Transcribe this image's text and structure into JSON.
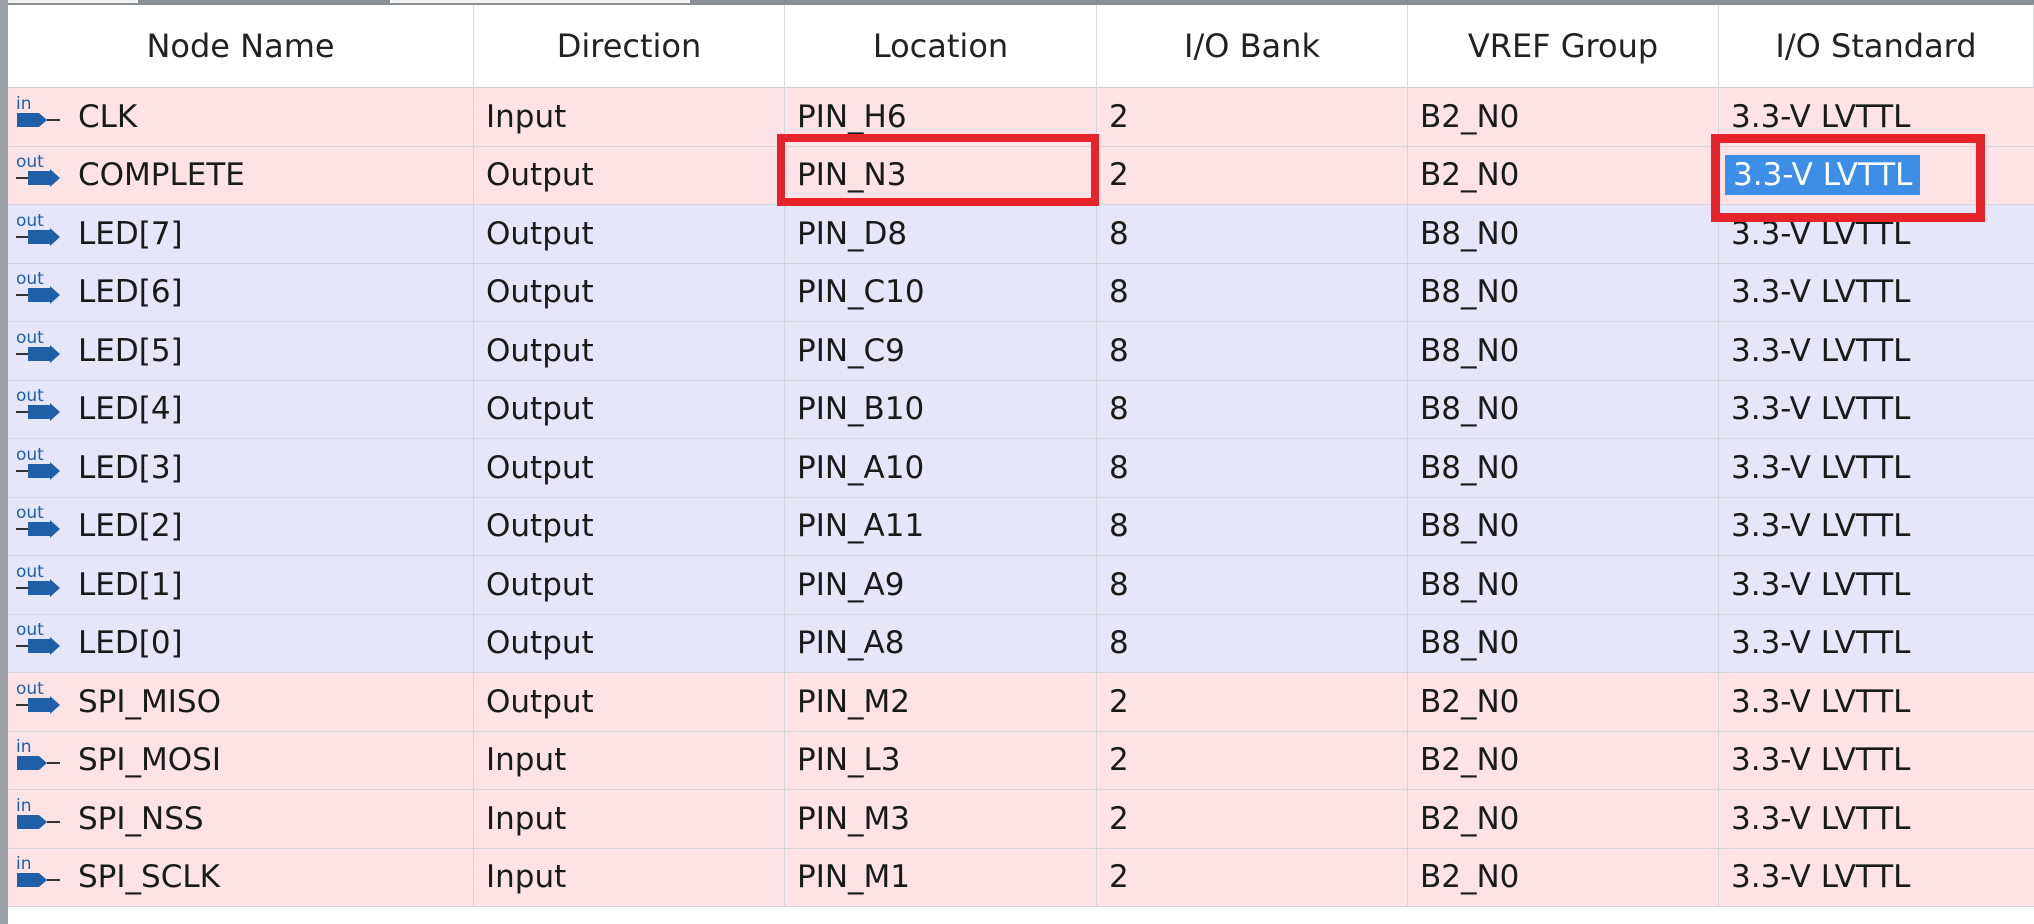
{
  "columns": [
    "Node Name",
    "Direction",
    "Location",
    "I/O Bank",
    "VREF Group",
    "I/O Standard"
  ],
  "rows": [
    {
      "dir_icon": "input-pin-icon",
      "icon_text": "in",
      "name": "CLK",
      "direction": "Input",
      "location": "PIN_H6",
      "bank": "2",
      "vref": "B2_N0",
      "standard": "3.3-V LVTTL",
      "tint": "pink"
    },
    {
      "dir_icon": "output-pin-icon",
      "icon_text": "out",
      "name": "COMPLETE",
      "direction": "Output",
      "location": "PIN_N3",
      "bank": "2",
      "vref": "B2_N0",
      "standard": "3.3-V LVTTL",
      "tint": "pink",
      "selected": true
    },
    {
      "dir_icon": "output-pin-icon",
      "icon_text": "out",
      "name": "LED[7]",
      "direction": "Output",
      "location": "PIN_D8",
      "bank": "8",
      "vref": "B8_N0",
      "standard": "3.3-V LVTTL",
      "tint": "lav"
    },
    {
      "dir_icon": "output-pin-icon",
      "icon_text": "out",
      "name": "LED[6]",
      "direction": "Output",
      "location": "PIN_C10",
      "bank": "8",
      "vref": "B8_N0",
      "standard": "3.3-V LVTTL",
      "tint": "lav"
    },
    {
      "dir_icon": "output-pin-icon",
      "icon_text": "out",
      "name": "LED[5]",
      "direction": "Output",
      "location": "PIN_C9",
      "bank": "8",
      "vref": "B8_N0",
      "standard": "3.3-V LVTTL",
      "tint": "lav"
    },
    {
      "dir_icon": "output-pin-icon",
      "icon_text": "out",
      "name": "LED[4]",
      "direction": "Output",
      "location": "PIN_B10",
      "bank": "8",
      "vref": "B8_N0",
      "standard": "3.3-V LVTTL",
      "tint": "lav"
    },
    {
      "dir_icon": "output-pin-icon",
      "icon_text": "out",
      "name": "LED[3]",
      "direction": "Output",
      "location": "PIN_A10",
      "bank": "8",
      "vref": "B8_N0",
      "standard": "3.3-V LVTTL",
      "tint": "lav"
    },
    {
      "dir_icon": "output-pin-icon",
      "icon_text": "out",
      "name": "LED[2]",
      "direction": "Output",
      "location": "PIN_A11",
      "bank": "8",
      "vref": "B8_N0",
      "standard": "3.3-V LVTTL",
      "tint": "lav"
    },
    {
      "dir_icon": "output-pin-icon",
      "icon_text": "out",
      "name": "LED[1]",
      "direction": "Output",
      "location": "PIN_A9",
      "bank": "8",
      "vref": "B8_N0",
      "standard": "3.3-V LVTTL",
      "tint": "lav"
    },
    {
      "dir_icon": "output-pin-icon",
      "icon_text": "out",
      "name": "LED[0]",
      "direction": "Output",
      "location": "PIN_A8",
      "bank": "8",
      "vref": "B8_N0",
      "standard": "3.3-V LVTTL",
      "tint": "lav"
    },
    {
      "dir_icon": "output-pin-icon",
      "icon_text": "out",
      "name": "SPI_MISO",
      "direction": "Output",
      "location": "PIN_M2",
      "bank": "2",
      "vref": "B2_N0",
      "standard": "3.3-V LVTTL",
      "tint": "pink"
    },
    {
      "dir_icon": "input-pin-icon",
      "icon_text": "in",
      "name": "SPI_MOSI",
      "direction": "Input",
      "location": "PIN_L3",
      "bank": "2",
      "vref": "B2_N0",
      "standard": "3.3-V LVTTL",
      "tint": "pink"
    },
    {
      "dir_icon": "input-pin-icon",
      "icon_text": "in",
      "name": "SPI_NSS",
      "direction": "Input",
      "location": "PIN_M3",
      "bank": "2",
      "vref": "B2_N0",
      "standard": "3.3-V LVTTL",
      "tint": "pink"
    },
    {
      "dir_icon": "input-pin-icon",
      "icon_text": "in",
      "name": "SPI_SCLK",
      "direction": "Input",
      "location": "PIN_M1",
      "bank": "2",
      "vref": "B2_N0",
      "standard": "3.3-V LVTTL",
      "tint": "pink"
    }
  ],
  "colors": {
    "bank2_row": "#fde3e5",
    "bank8_row": "#e6e6fb",
    "selection": "#3d8ee6",
    "highlight_box": "#e5232b",
    "icon_blue": "#1f5fa8"
  }
}
